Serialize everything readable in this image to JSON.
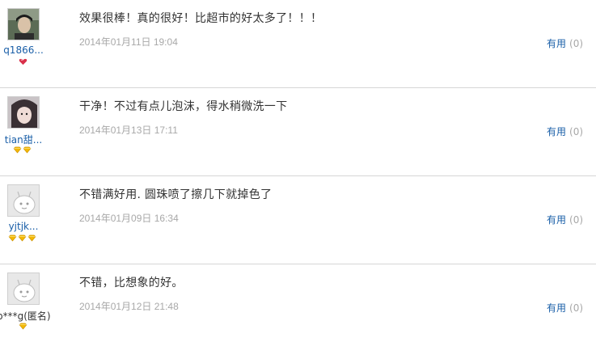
{
  "reviews": [
    {
      "username": "q1866...",
      "content": "效果很棒！真的很好！比超市的好太多了！！！",
      "date": "2014年01月11日 19:04",
      "useful_label": "有用",
      "useful_count": "(0)",
      "avatar": "photo",
      "badge_icon": "heart-gem-icon",
      "badge_count": 1
    },
    {
      "username": "tian甜...",
      "content": "干净！不过有点儿泡沫，得水稍微洗一下",
      "date": "2014年01月13日 17:11",
      "useful_label": "有用",
      "useful_count": "(0)",
      "avatar": "photo",
      "badge_icon": "gold-gem-icon",
      "badge_count": 2
    },
    {
      "username": "yjtjk...",
      "content": "不错满好用. 圆珠喷了擦几下就掉色了",
      "date": "2014年01月09日 16:34",
      "useful_label": "有用",
      "useful_count": "(0)",
      "avatar": "default",
      "badge_icon": "gold-gem-icon",
      "badge_count": 3
    },
    {
      "username": "p***g(匿名)",
      "content": "不错，比想象的好。",
      "date": "2014年01月12日 21:48",
      "useful_label": "有用",
      "useful_count": "(0)",
      "avatar": "default",
      "badge_icon": "gold-gem-icon",
      "badge_count": 1
    }
  ],
  "colors": {
    "link": "#1a5fa8",
    "muted": "#a8a8a8",
    "text": "#333333",
    "gem": "#f2b705",
    "heart": "#d9304a"
  }
}
